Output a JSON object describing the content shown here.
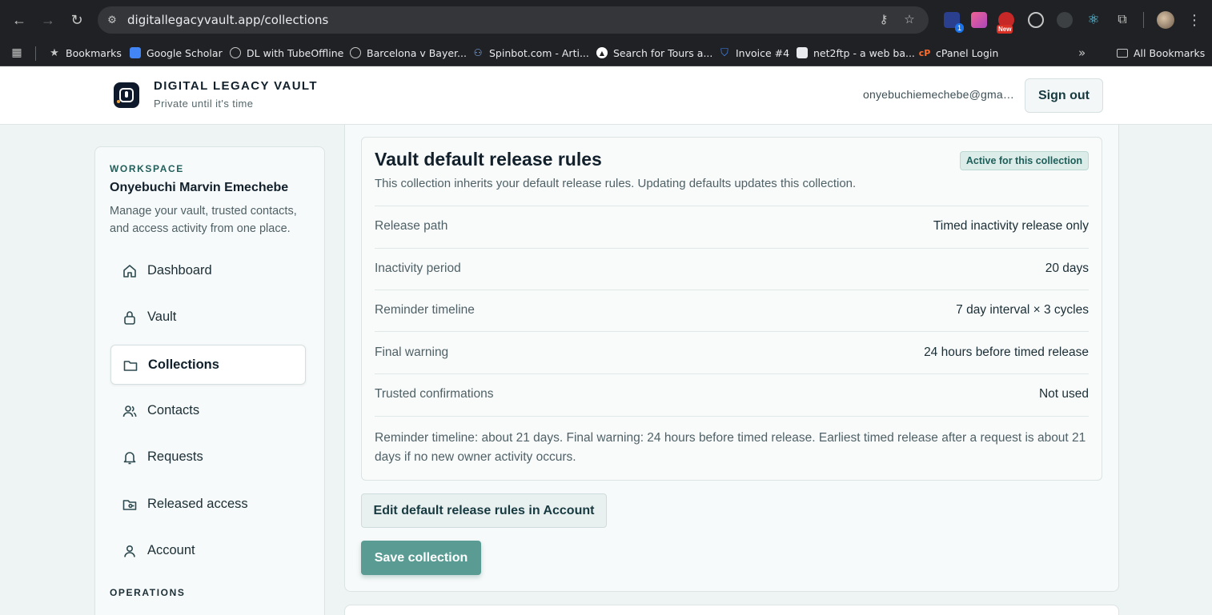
{
  "browser": {
    "url": "digitallegacyvault.app/collections",
    "bookmarks": [
      {
        "label": "Bookmarks",
        "icon": "star-icon"
      },
      {
        "label": "Google Scholar",
        "icon": "scholar-icon"
      },
      {
        "label": "DL with TubeOffline",
        "icon": "globe-icon"
      },
      {
        "label": "Barcelona v Bayer...",
        "icon": "globe-icon"
      },
      {
        "label": "Spinbot.com - Arti...",
        "icon": "spinbot-icon"
      },
      {
        "label": "Search for Tours a...",
        "icon": "triangle-icon"
      },
      {
        "label": "Invoice #4",
        "icon": "shield-icon"
      },
      {
        "label": "net2ftp - a web ba...",
        "icon": "page-icon"
      },
      {
        "label": "cPanel Login",
        "icon": "cpanel-icon"
      }
    ],
    "all_bookmarks": "All Bookmarks",
    "extension_badge_count": "1",
    "extension_new_label": "New"
  },
  "header": {
    "brand_name": "DIGITAL LEGACY VAULT",
    "brand_tagline": "Private until it's time",
    "user_email": "onyebuchiemechebe@gmail.com",
    "sign_out": "Sign out"
  },
  "sidebar": {
    "workspace_label": "WORKSPACE",
    "workspace_name": "Onyebuchi Marvin Emechebe",
    "workspace_desc": "Manage your vault, trusted contacts, and access activity from one place.",
    "items": [
      {
        "label": "Dashboard",
        "icon": "home-icon"
      },
      {
        "label": "Vault",
        "icon": "lock-icon"
      },
      {
        "label": "Collections",
        "icon": "folder-icon",
        "active": true
      },
      {
        "label": "Contacts",
        "icon": "users-icon"
      },
      {
        "label": "Requests",
        "icon": "bell-icon"
      },
      {
        "label": "Released access",
        "icon": "folder-open-icon"
      },
      {
        "label": "Account",
        "icon": "user-icon"
      }
    ],
    "operations_label": "OPERATIONS"
  },
  "rules": {
    "title": "Vault default release rules",
    "subtitle": "This collection inherits your default release rules. Updating defaults updates this collection.",
    "badge": "Active for this collection",
    "rows": [
      {
        "label": "Release path",
        "value": "Timed inactivity release only"
      },
      {
        "label": "Inactivity period",
        "value": "20 days"
      },
      {
        "label": "Reminder timeline",
        "value": "7 day interval × 3 cycles"
      },
      {
        "label": "Final warning",
        "value": "24 hours before timed release"
      },
      {
        "label": "Trusted confirmations",
        "value": "Not used"
      }
    ],
    "summary": "Reminder timeline: about 21 days. Final warning: 24 hours before timed release. Earliest timed release after a request is about 21 days if no new owner activity occurs."
  },
  "actions": {
    "edit_defaults": "Edit default release rules in Account",
    "save": "Save collection"
  },
  "colors": {
    "accent": "#5a9c94",
    "brand_dark": "#0e1a2b",
    "badge_bg": "#dcece9"
  }
}
